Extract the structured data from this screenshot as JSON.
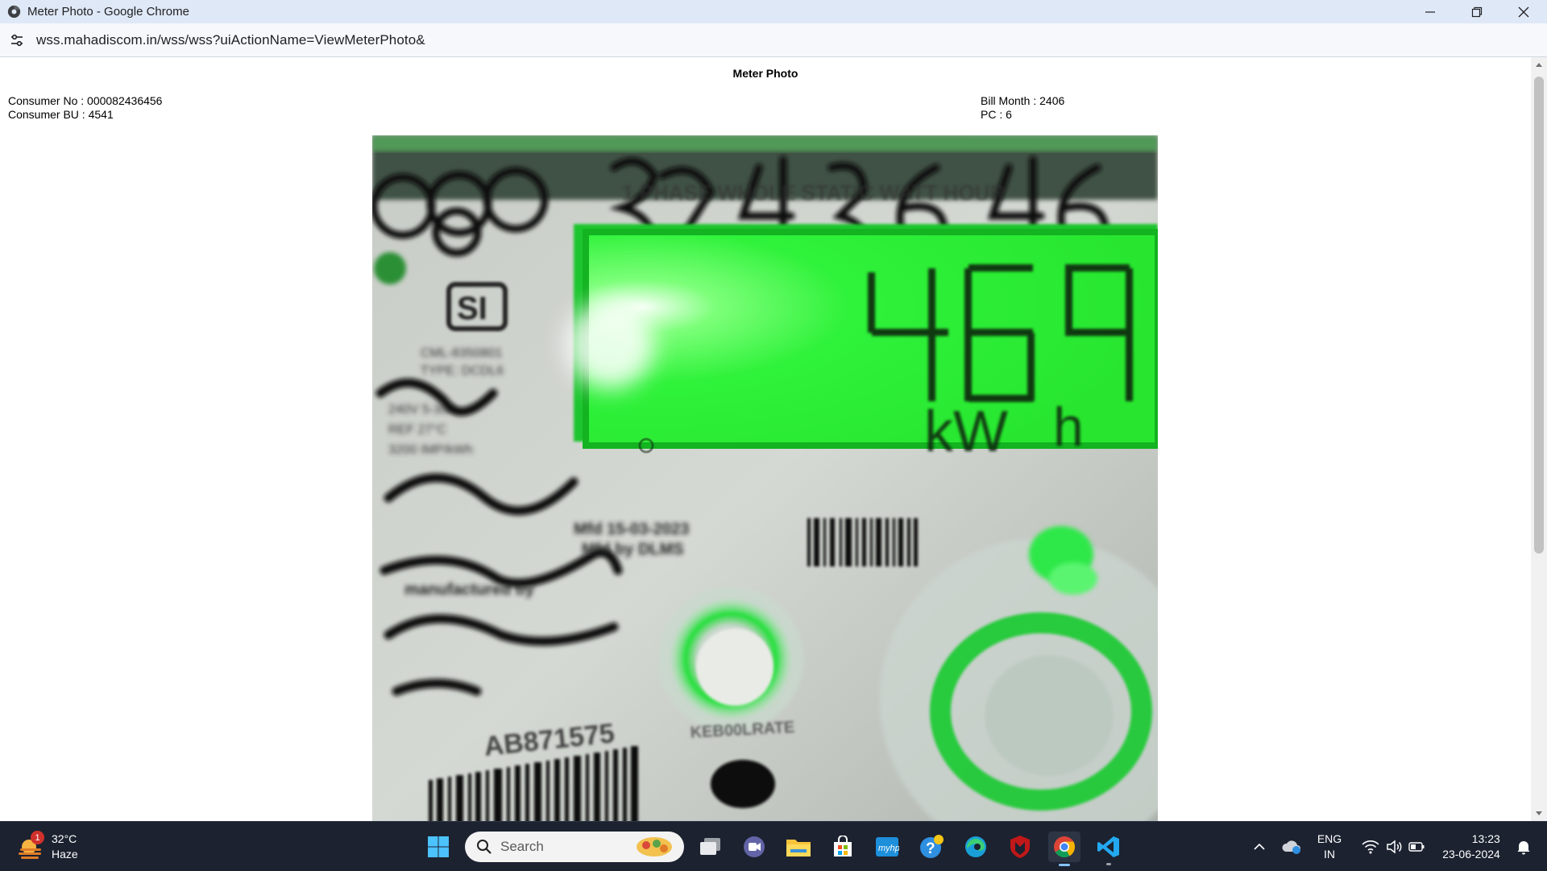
{
  "window": {
    "title": "Meter Photo - Google Chrome",
    "url": "wss.mahadiscom.in/wss/wss?uiActionName=ViewMeterPhoto&"
  },
  "page": {
    "title": "Meter Photo",
    "consumer_no": "Consumer No : 000082436456",
    "consumer_bu": "Consumer BU : 4541",
    "bill_month": "Bill Month : 2406",
    "pc": "PC : 6"
  },
  "meter_photo": {
    "reading": "469",
    "unit_k": "kW",
    "unit_h": "h",
    "handwritten_number": "000082436456",
    "dial_label": "KEB00LRATE",
    "serial_label": "AB871575",
    "display_color": "#2cff3a"
  },
  "taskbar": {
    "weather_temp": "32°C",
    "weather_desc": "Haze",
    "weather_badge": "1",
    "search_label": "Search",
    "language_line1": "ENG",
    "language_line2": "IN",
    "time": "13:23",
    "date": "23-06-2024",
    "background_color": "#1c2230",
    "icons": [
      "windows-start-icon",
      "task-view-icon",
      "meet-icon",
      "file-explorer-icon",
      "microsoft-store-icon",
      "myhp-icon",
      "get-help-icon",
      "edge-icon",
      "mcafee-icon",
      "chrome-icon",
      "vscode-icon"
    ]
  },
  "colors": {
    "chrome_frame": "#dfe8f7",
    "address_bar": "#f6f8fc",
    "accent": "#86c3ff"
  }
}
